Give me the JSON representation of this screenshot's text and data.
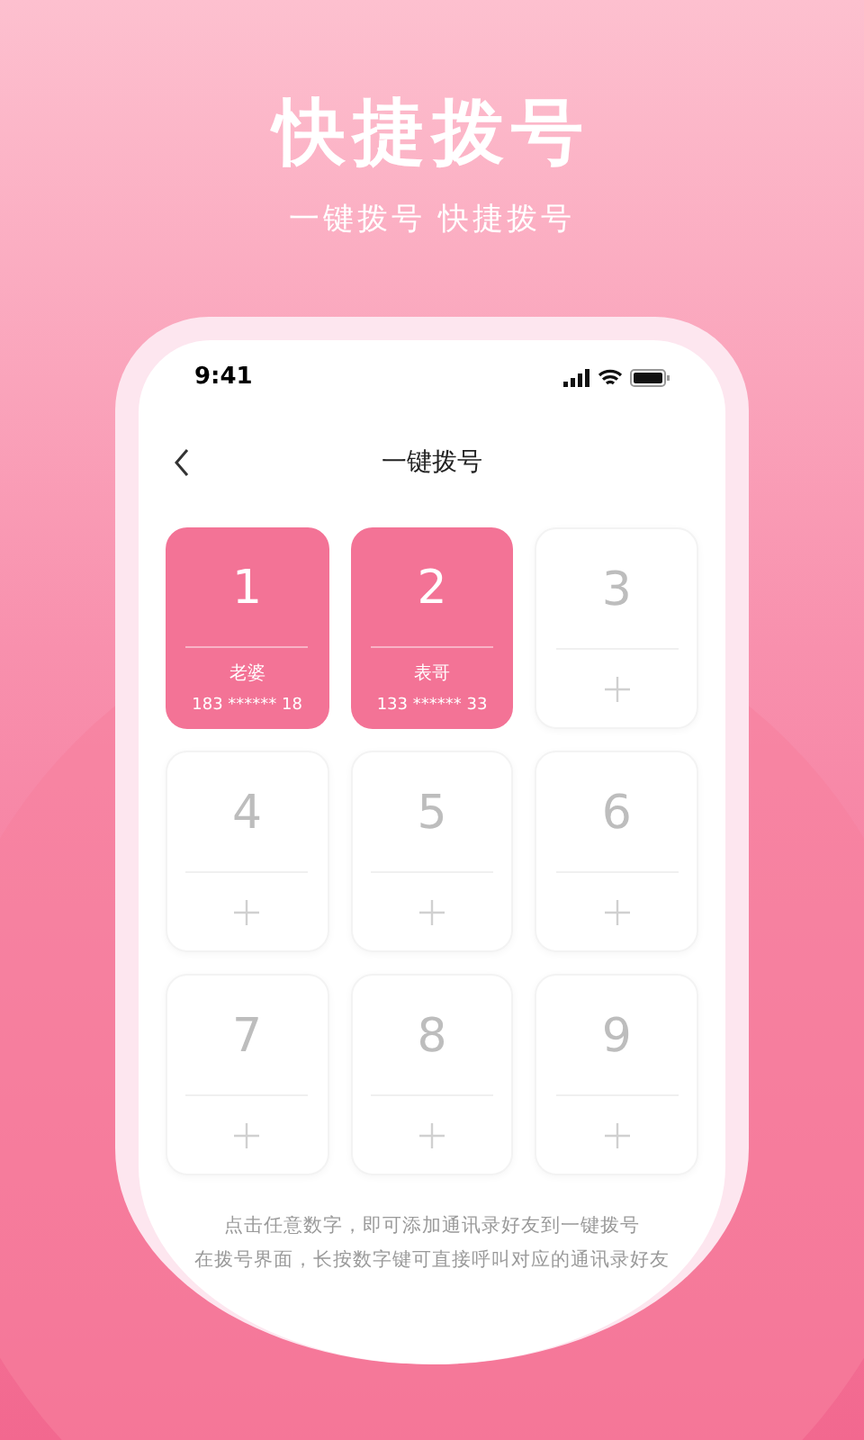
{
  "header": {
    "title": "快捷拨号",
    "subtitle": "一键拨号 快捷拨号"
  },
  "status_bar": {
    "time": "9:41"
  },
  "nav": {
    "title": "一键拨号"
  },
  "keys": [
    {
      "number": "1",
      "kind": "contact",
      "name": "老婆",
      "phone": "183 ****** 18"
    },
    {
      "number": "2",
      "kind": "contact",
      "name": "表哥",
      "phone": "133 ****** 33"
    },
    {
      "number": "3",
      "kind": "empty"
    },
    {
      "number": "4",
      "kind": "empty"
    },
    {
      "number": "5",
      "kind": "empty"
    },
    {
      "number": "6",
      "kind": "empty"
    },
    {
      "number": "7",
      "kind": "empty"
    },
    {
      "number": "8",
      "kind": "empty"
    },
    {
      "number": "9",
      "kind": "empty"
    }
  ],
  "hints": [
    "点击任意数字，即可添加通讯录好友到一键拨号",
    "在拨号界面，长按数字键可直接呼叫对应的通讯录好友"
  ]
}
